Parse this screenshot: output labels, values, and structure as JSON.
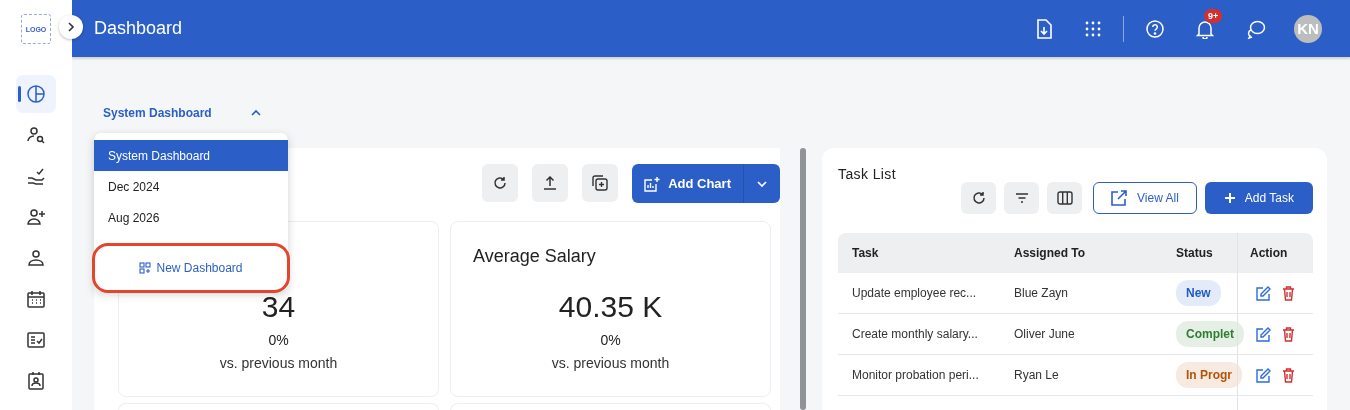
{
  "logo": "LOGO",
  "header": {
    "title": "Dashboard",
    "notification_badge": "9+",
    "avatar_initials": "KN"
  },
  "sidebar": {
    "items": [
      {
        "selected": true
      },
      {
        "selected": false
      },
      {
        "selected": false
      },
      {
        "selected": false
      },
      {
        "selected": false
      },
      {
        "selected": false
      },
      {
        "selected": false
      },
      {
        "selected": false
      }
    ]
  },
  "dashboard_selector": {
    "label": "System Dashboard",
    "expanded": true,
    "options": [
      {
        "label": "System Dashboard",
        "selected": true
      },
      {
        "label": "Dec 2024",
        "selected": false
      },
      {
        "label": "Aug 2026",
        "selected": false
      }
    ],
    "new_action": "New Dashboard"
  },
  "toolbar": {
    "add_chart": "Add Chart"
  },
  "stat_cards": [
    {
      "value": "34",
      "change": "0%",
      "caption": "vs. previous month"
    },
    {
      "title": "Average Salary",
      "value": "40.35 K",
      "change": "0%",
      "caption": "vs. previous month"
    }
  ],
  "task_list": {
    "title": "Task List",
    "view_all": "View All",
    "add_task": "Add Task",
    "columns": [
      "Task",
      "Assigned To",
      "Status",
      "Action"
    ],
    "rows": [
      {
        "task": "Update employee rec...",
        "assigned_to": "Blue Zayn",
        "status": "New",
        "color": "#1e5bc6"
      },
      {
        "task": "Create monthly salary...",
        "assigned_to": "Oliver June",
        "status": "Complet",
        "color": "#2e7d32"
      },
      {
        "task": "Monitor probation peri...",
        "assigned_to": "Ryan Le",
        "status": "In Progr",
        "color": "#b45309"
      }
    ]
  }
}
